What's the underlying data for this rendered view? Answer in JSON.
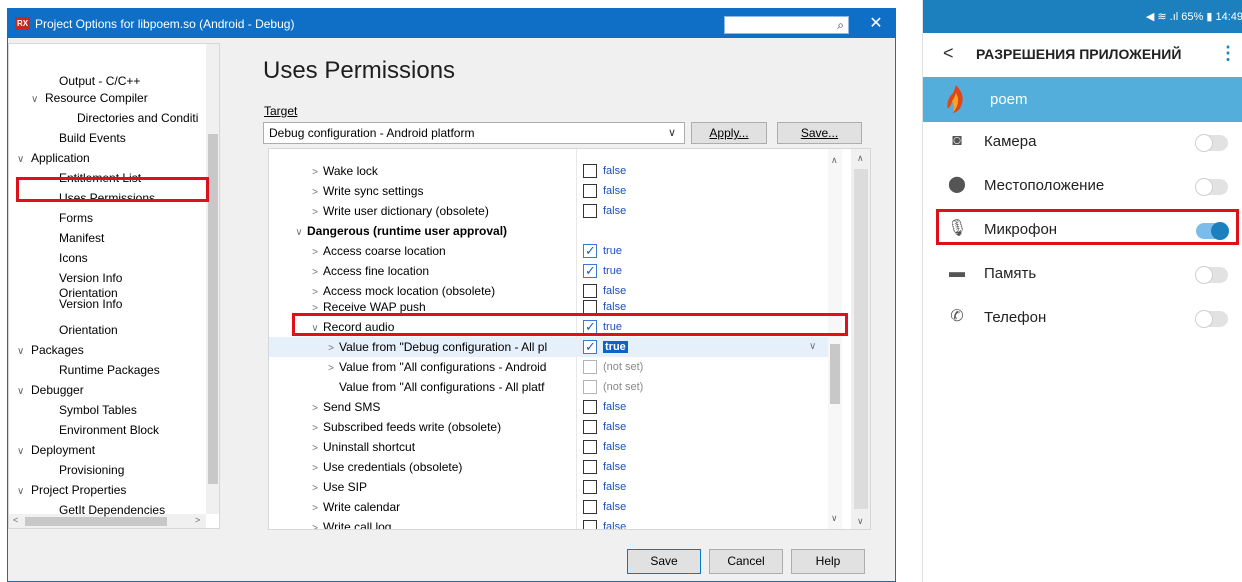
{
  "dialog": {
    "title": "Project Options for libpoem.so  (Android - Debug)",
    "logo_text": "RX",
    "close_glyph": "✕",
    "heading": "Uses Permissions",
    "target_label": "Target",
    "target_value": "Debug configuration - Android platform",
    "apply_label": "Apply...",
    "save_target_label": "Save...",
    "footer": {
      "save": "Save",
      "cancel": "Cancel",
      "help": "Help"
    }
  },
  "tree": [
    {
      "label": "Output - C/C++",
      "chev": "",
      "indent": 2
    },
    {
      "label": "Resource Compiler",
      "chev": "∨",
      "indent": 1
    },
    {
      "label": "Directories and Conditi",
      "chev": "",
      "indent": 3
    },
    {
      "label": "Build Events",
      "chev": "",
      "indent": 2
    },
    {
      "label": "Application",
      "chev": "∨",
      "indent": 0
    },
    {
      "label": "Entitlement List",
      "chev": "",
      "indent": 2
    },
    {
      "label": "Uses Permissions",
      "chev": "",
      "indent": 2
    },
    {
      "label": "Forms",
      "chev": "",
      "indent": 2
    },
    {
      "label": "Manifest",
      "chev": "",
      "indent": 2
    },
    {
      "label": "Icons",
      "chev": "",
      "indent": 2
    },
    {
      "label": "Version Info",
      "chev": "",
      "indent": 2
    },
    {
      "label": "Orientation Version Info",
      "chev": "",
      "indent": 2
    },
    {
      "label": "Orientation",
      "chev": "",
      "indent": 2
    },
    {
      "label": "Packages",
      "chev": "∨",
      "indent": 0
    },
    {
      "label": "Runtime Packages",
      "chev": "",
      "indent": 2
    },
    {
      "label": "Debugger",
      "chev": "∨",
      "indent": 0
    },
    {
      "label": "Symbol Tables",
      "chev": "",
      "indent": 2
    },
    {
      "label": "Environment Block",
      "chev": "",
      "indent": 2
    },
    {
      "label": "Deployment",
      "chev": "∨",
      "indent": 0
    },
    {
      "label": "Provisioning",
      "chev": "",
      "indent": 2
    },
    {
      "label": "Project Properties",
      "chev": "∨",
      "indent": 0
    },
    {
      "label": "GetIt Dependencies",
      "chev": "",
      "indent": 2
    }
  ],
  "permissions": [
    {
      "label": "Wake lock",
      "chev": ">",
      "level": 1,
      "value": "false",
      "state": "unchecked"
    },
    {
      "label": "Write sync settings",
      "chev": ">",
      "level": 1,
      "value": "false",
      "state": "unchecked"
    },
    {
      "label": "Write user dictionary (obsolete)",
      "chev": ">",
      "level": 1,
      "value": "false",
      "state": "unchecked"
    },
    {
      "label": "Dangerous (runtime user approval)",
      "chev": "∨",
      "level": 0,
      "value": "",
      "state": "none",
      "bold": true
    },
    {
      "label": "Access coarse location",
      "chev": ">",
      "level": 1,
      "value": "true",
      "state": "checked"
    },
    {
      "label": "Access fine location",
      "chev": ">",
      "level": 1,
      "value": "true",
      "state": "checked"
    },
    {
      "label": "Access mock location (obsolete)",
      "chev": ">",
      "level": 1,
      "value": "false",
      "state": "unchecked"
    },
    {
      "label": "Receive WAP push",
      "chev": ">",
      "level": 1,
      "value": "false",
      "state": "unchecked"
    },
    {
      "label": "Record audio",
      "chev": "∨",
      "level": 1,
      "value": "true",
      "state": "checked"
    },
    {
      "label": "Value from \"Debug configuration - All pl",
      "chev": ">",
      "level": 2,
      "value": "true",
      "state": "checked",
      "selected": true
    },
    {
      "label": "Value from \"All configurations - Android",
      "chev": ">",
      "level": 2,
      "value": "(not set)",
      "state": "dim"
    },
    {
      "label": "Value from \"All configurations - All platf",
      "chev": "",
      "level": 2,
      "value": "(not set)",
      "state": "dim"
    },
    {
      "label": "Send SMS",
      "chev": ">",
      "level": 1,
      "value": "false",
      "state": "unchecked"
    },
    {
      "label": "Subscribed feeds write (obsolete)",
      "chev": ">",
      "level": 1,
      "value": "false",
      "state": "unchecked"
    },
    {
      "label": "Uninstall shortcut",
      "chev": ">",
      "level": 1,
      "value": "false",
      "state": "unchecked"
    },
    {
      "label": "Use credentials (obsolete)",
      "chev": ">",
      "level": 1,
      "value": "false",
      "state": "unchecked"
    },
    {
      "label": "Use SIP",
      "chev": ">",
      "level": 1,
      "value": "false",
      "state": "unchecked"
    },
    {
      "label": "Write calendar",
      "chev": ">",
      "level": 1,
      "value": "false",
      "state": "unchecked"
    },
    {
      "label": "Write call log",
      "chev": ">",
      "level": 1,
      "value": "false",
      "state": "unchecked"
    }
  ],
  "phone": {
    "status": "◀ ≋ .ıl 65% ▮ 14:49",
    "title": "РАЗРЕШЕНИЯ ПРИЛОЖЕНИЙ",
    "back_glyph": "<",
    "menu_glyph": "⋮",
    "app_name": "poem",
    "permissions": [
      {
        "label": "Камера",
        "icon": "camera-icon",
        "glyph": "◙",
        "on": false
      },
      {
        "label": "Местоположение",
        "icon": "location-pin-icon",
        "glyph": "⬤",
        "on": false
      },
      {
        "label": "Микрофон",
        "icon": "microphone-icon",
        "glyph": "🎙",
        "on": true
      },
      {
        "label": "Память",
        "icon": "folder-icon",
        "glyph": "▬",
        "on": false
      },
      {
        "label": "Телефон",
        "icon": "phone-icon",
        "glyph": "✆",
        "on": false
      }
    ]
  },
  "colors": {
    "title_bar": "#0f6fc6",
    "highlight": "#e0101a",
    "android_primary": "#1c80bf",
    "app_banner": "#53aedc"
  }
}
